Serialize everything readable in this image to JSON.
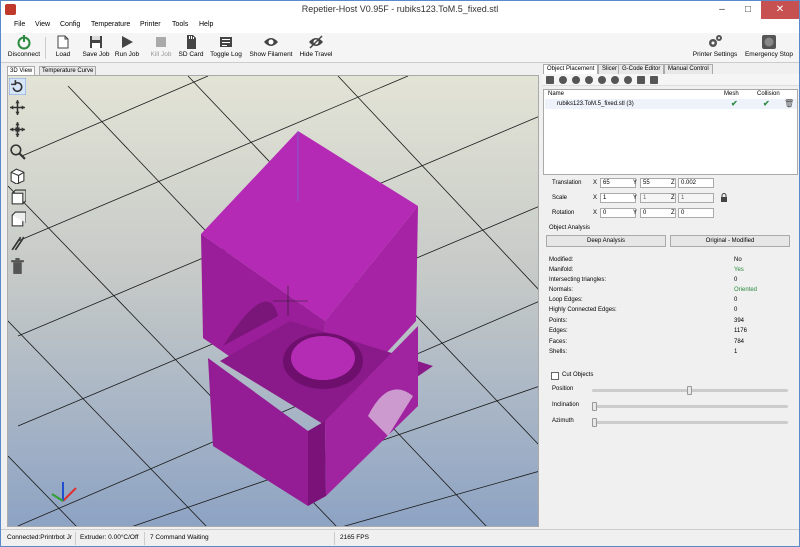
{
  "window": {
    "title": "Repetier-Host V0.95F - rubiks123.ToM.5_fixed.stl"
  },
  "menu": [
    "File",
    "View",
    "Config",
    "Temperature",
    "Printer",
    "Tools",
    "Help"
  ],
  "toolbar": {
    "disconnect": "Disconnect",
    "load": "Load",
    "save_job": "Save Job",
    "run_job": "Run Job",
    "kill_job": "Kill Job",
    "sd_card": "SD Card",
    "toggle_log": "Toggle Log",
    "show_filament": "Show Filament",
    "hide_travel": "Hide Travel",
    "printer_settings": "Printer Settings",
    "emergency_stop": "Emergency Stop"
  },
  "view_tabs": [
    "3D View",
    "Temperature Curve"
  ],
  "right_tabs": [
    "Object Placement",
    "Slicer",
    "G-Code Editor",
    "Manual Control"
  ],
  "object_table": {
    "headers": {
      "name": "Name",
      "mesh": "Mesh",
      "collision": "Collision"
    },
    "rows": [
      {
        "name": "rubiks123.ToM.5_fixed.stl (3)"
      }
    ]
  },
  "transform": {
    "translation_label": "Translation",
    "scale_label": "Scale",
    "rotation_label": "Rotation",
    "axis_x": "X",
    "axis_y": "Y",
    "axis_z": "Z",
    "translation": {
      "x": "65",
      "y": "55",
      "z": "0.002"
    },
    "scale": {
      "x": "1",
      "y": "1",
      "z": "1"
    },
    "rotation": {
      "x": "0",
      "y": "0",
      "z": "0"
    }
  },
  "analysis": {
    "section_title": "Object Analysis",
    "deep_analysis_button": "Deep Analysis",
    "original_modified_button": "Original - Modified",
    "rows": [
      {
        "label": "Modified:",
        "value": "No"
      },
      {
        "label": "Manifold:",
        "value": "Yes"
      },
      {
        "label": "Intersecting triangles:",
        "value": "0"
      },
      {
        "label": "Normals:",
        "value": "Oriented"
      },
      {
        "label": "Loop Edges:",
        "value": "0"
      },
      {
        "label": "Highly Connected Edges:",
        "value": "0"
      },
      {
        "label": "Points:",
        "value": "394"
      },
      {
        "label": "Edges:",
        "value": "1176"
      },
      {
        "label": "Faces:",
        "value": "784"
      },
      {
        "label": "Shells:",
        "value": "1"
      }
    ],
    "colors": {
      "good": "#2b8a3e"
    }
  },
  "cut": {
    "checkbox_label": "Cut Objects",
    "position_label": "Position",
    "inclination_label": "Inclination",
    "azimuth_label": "Azimuth",
    "position_value": 0.5,
    "inclination_value": 0.0,
    "azimuth_value": 0.0
  },
  "status": {
    "connection": "Connected:Printrbot Jr",
    "extruder": "Extruder: 0.00°C/Off",
    "commands": "7 Command Waiting",
    "fps": "2165 FPS"
  },
  "icons": {
    "disconnect": "power-icon",
    "load": "folder-icon",
    "save_job": "floppy-icon",
    "run_job": "play-icon",
    "kill_job": "stop-icon",
    "sd_card": "sd-card-icon",
    "toggle_log": "log-icon",
    "show_filament": "eye-icon",
    "hide_travel": "eye-slash-icon",
    "printer_settings": "gears-icon",
    "emergency_stop": "emergency-stop-icon"
  },
  "colors": {
    "model": "#a020a0",
    "accent": "#3a7bd5"
  }
}
